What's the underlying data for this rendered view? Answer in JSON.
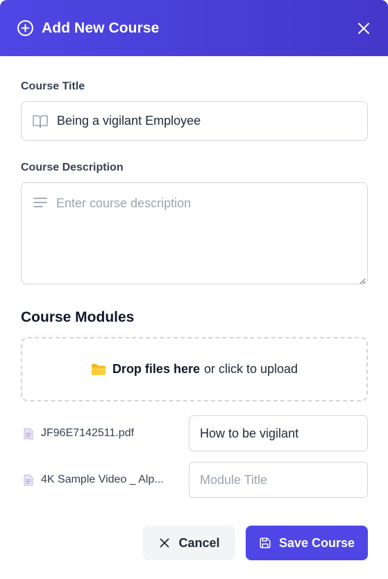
{
  "header": {
    "title": "Add New Course",
    "plus_icon": "plus-circle-icon",
    "close_icon": "close-icon",
    "gradient": [
      "#4f46e5",
      "#4338ca"
    ]
  },
  "form": {
    "title_label": "Course Title",
    "title_value": "Being a vigilant Employee",
    "title_icon": "book-open-icon",
    "description_label": "Course Description",
    "description_placeholder": "Enter course description",
    "description_icon": "align-left-icon"
  },
  "modules": {
    "heading": "Course Modules",
    "dropzone": {
      "bold_text": "Drop files here",
      "rest_text": "or click to upload",
      "icon": "folder-icon"
    },
    "items": [
      {
        "file_name": "JF96E7142511.pdf",
        "title_value": "How to be vigilant",
        "title_placeholder": "Module Title"
      },
      {
        "file_name": "4K Sample Video _ Alp...",
        "title_value": "",
        "title_placeholder": "Module Title"
      }
    ]
  },
  "actions": {
    "cancel_label": "Cancel",
    "save_label": "Save Course",
    "primary_color": "#4f46e5"
  }
}
